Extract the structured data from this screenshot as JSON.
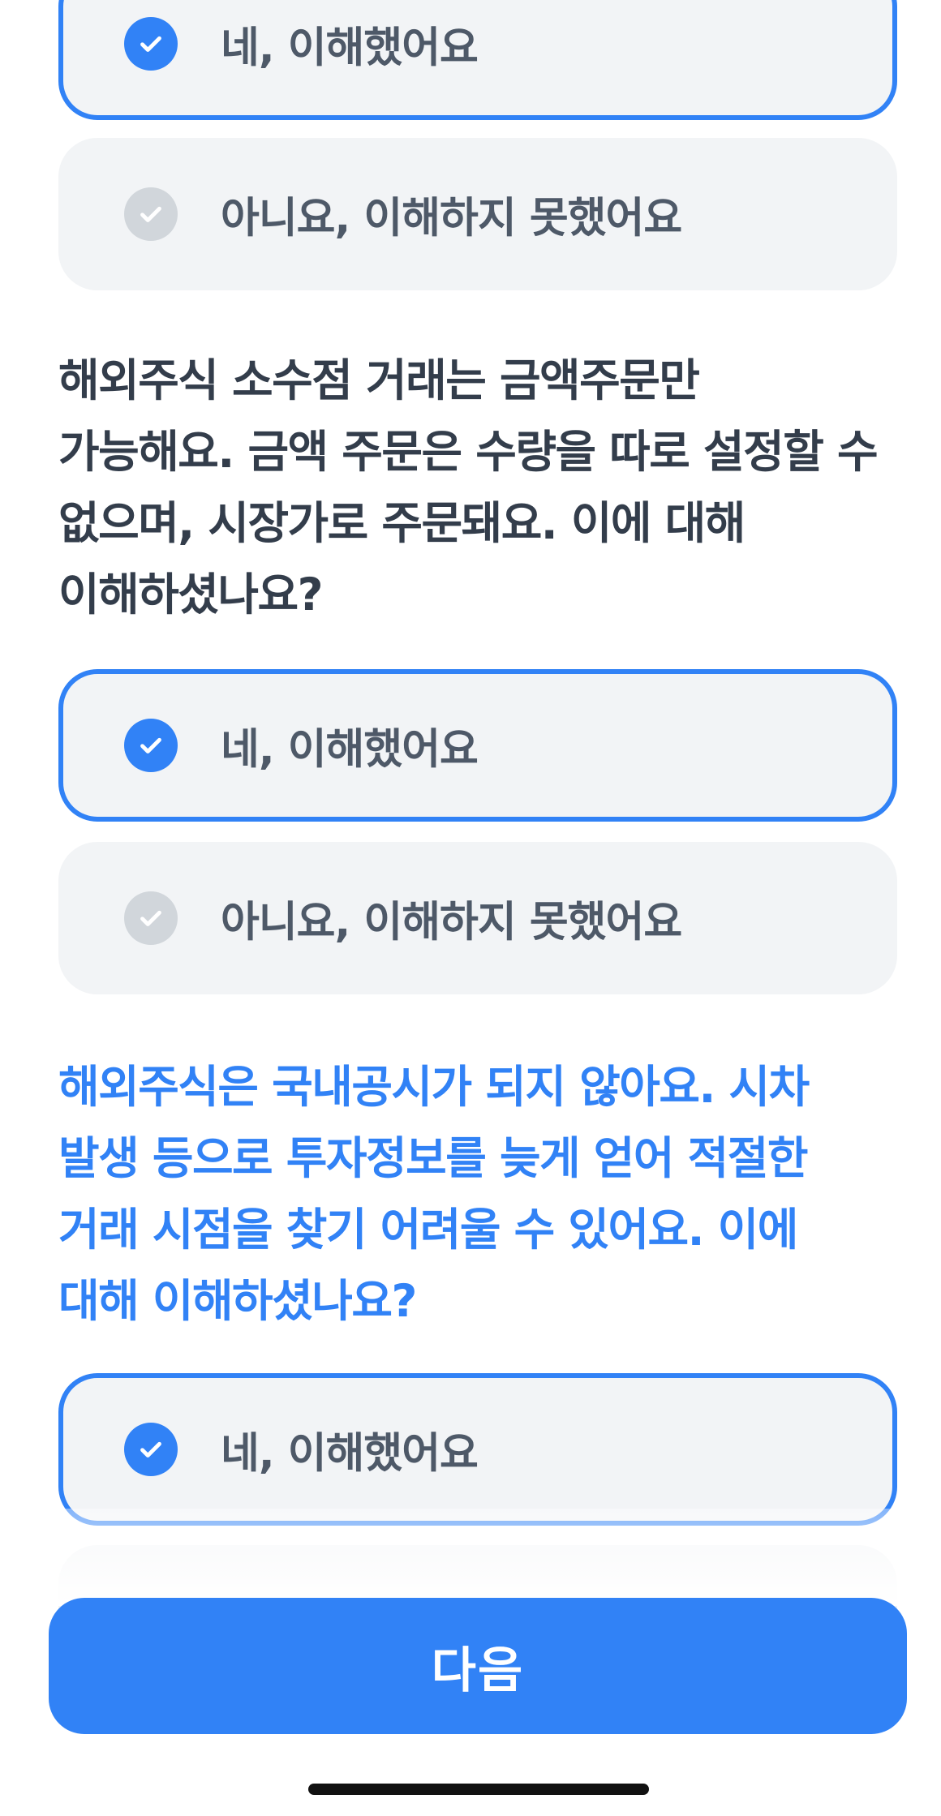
{
  "groups": [
    {
      "question_lines": [],
      "options": [
        {
          "label": "네, 이해했어요",
          "selected": true
        },
        {
          "label": "아니요, 이해하지 못했어요",
          "selected": false
        }
      ]
    },
    {
      "question_lines": [
        "해외주식 소수점 거래는 금액주문만",
        "가능해요. 금액 주문은 수량을 따로 설정할 수",
        "없으며, 시장가로 주문돼요. 이에 대해",
        "이해하셨나요?"
      ],
      "options": [
        {
          "label": "네, 이해했어요",
          "selected": true
        },
        {
          "label": "아니요, 이해하지 못했어요",
          "selected": false
        }
      ]
    },
    {
      "question_lines": [
        "해외주식은 국내공시가 되지 않아요. 시차",
        "발생 등으로 투자정보를 늦게 얻어 적절한",
        "거래 시점을 찾기 어려울 수 있어요. 이에",
        "대해 이해하셨나요?"
      ],
      "options": [
        {
          "label": "네, 이해했어요",
          "selected": true
        }
      ]
    }
  ],
  "next_button": {
    "label": "다음"
  },
  "colors": {
    "accent": "#3182f6",
    "option_bg": "#f2f4f6",
    "text": "#333d4b",
    "unchecked": "#d1d6db"
  }
}
